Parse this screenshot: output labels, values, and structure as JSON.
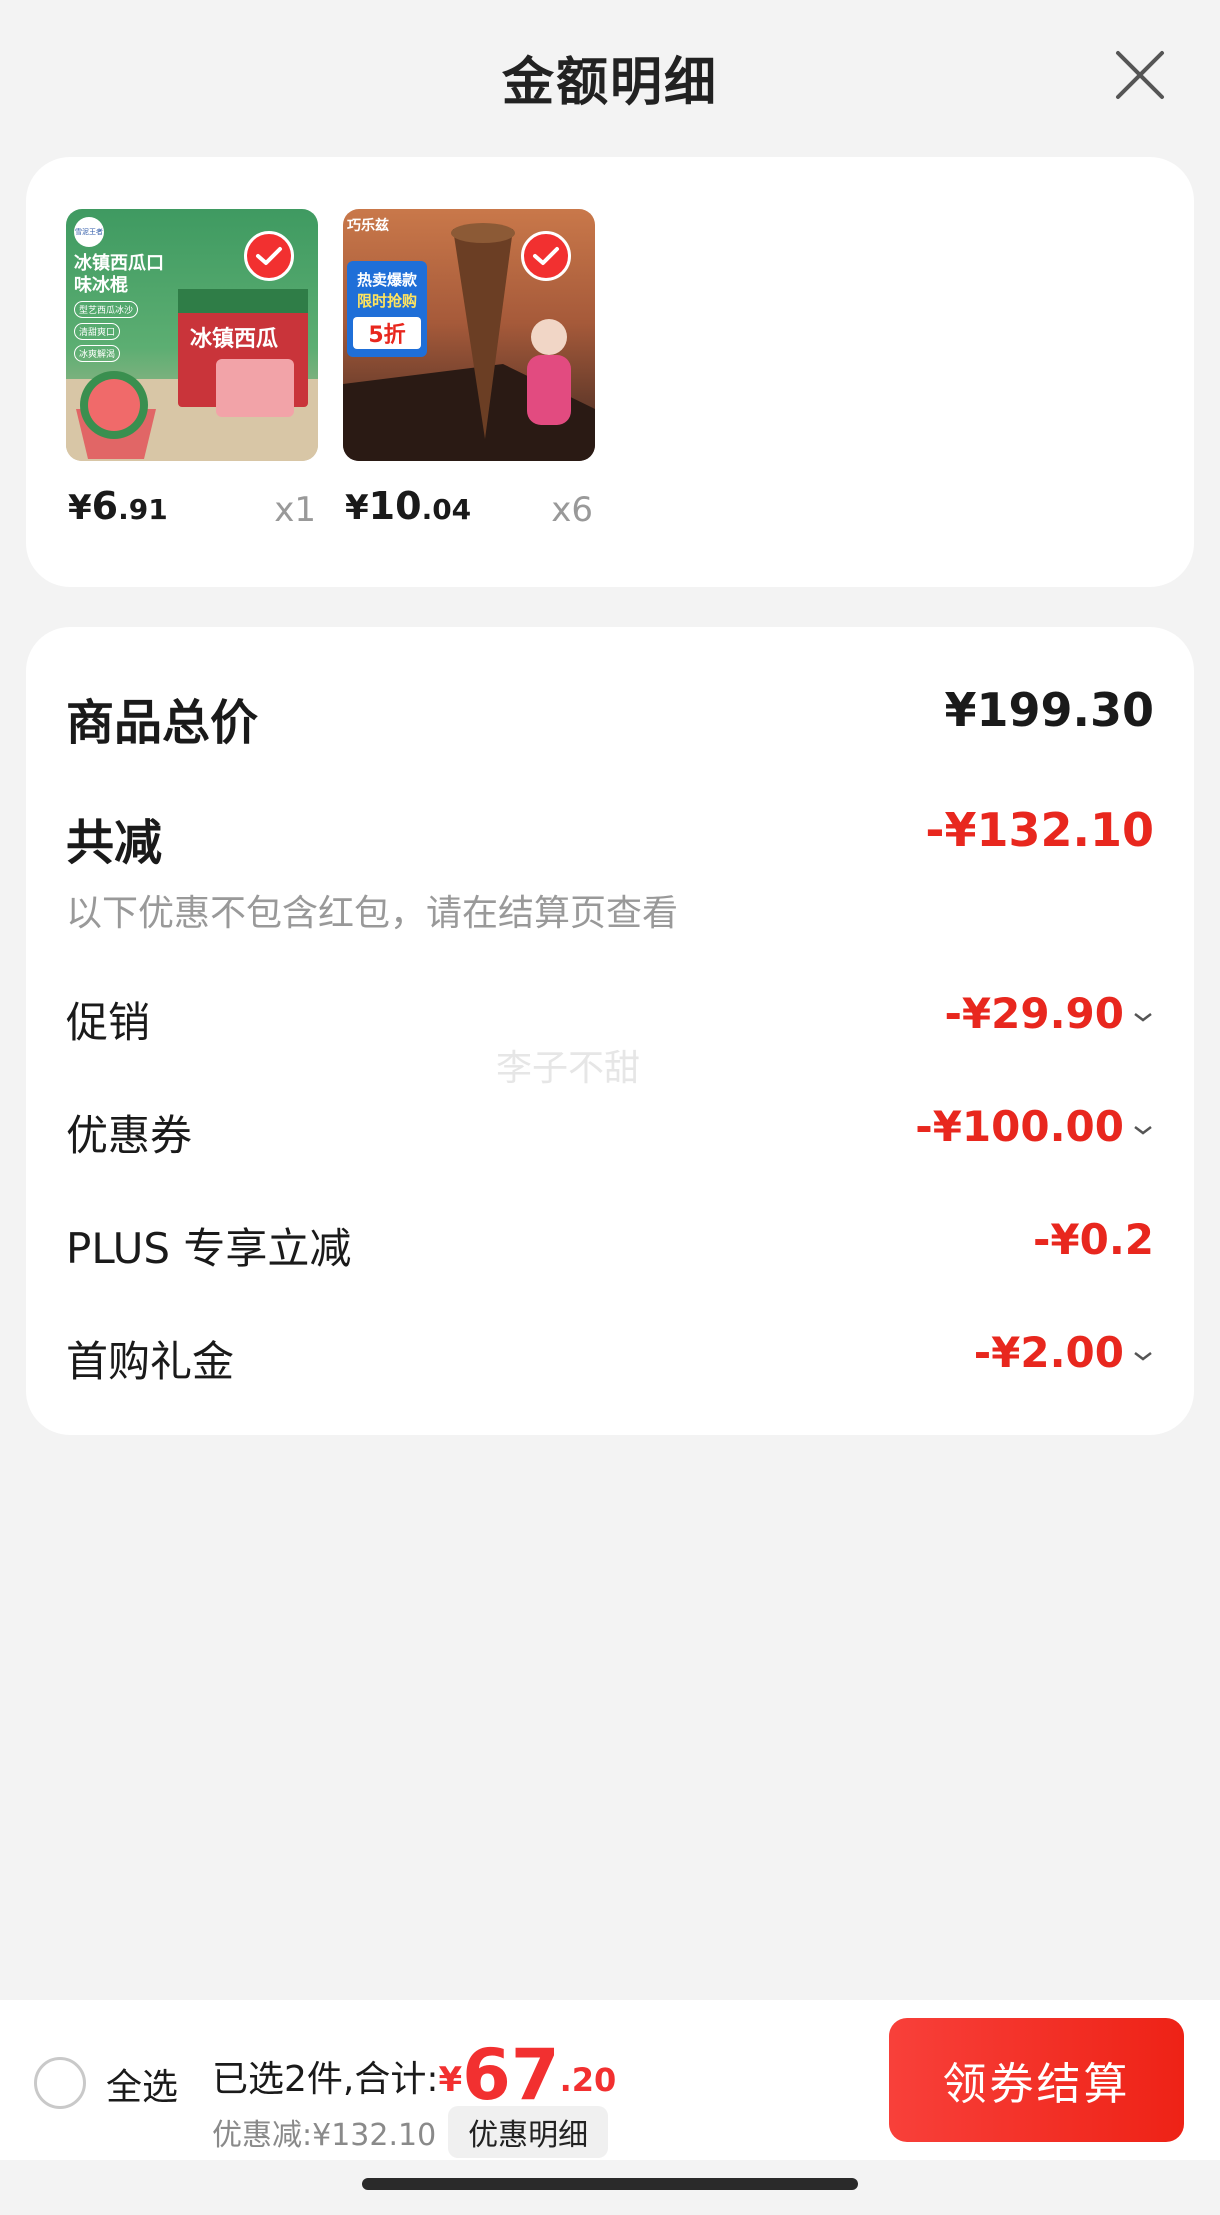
{
  "header": {
    "title": "金额明细"
  },
  "products": [
    {
      "thumb_text": "冰镇西瓜口味冰棍",
      "brand_mark": "雪泥王者",
      "tags": [
        "型艺西瓜冰沙",
        "清甜爽口",
        "冰爽解渴"
      ],
      "box_label": "冰镇西瓜",
      "price_currency": "¥",
      "price_int": "6",
      "price_dec": ".91",
      "qty": "x1",
      "selected": true
    },
    {
      "banner_top": "热卖爆款",
      "banner_mid": "限时抢购",
      "promo": "5折",
      "cone_label": "巧乐兹",
      "price_currency": "¥",
      "price_int": "10",
      "price_dec": ".04",
      "qty": "x6",
      "selected": true
    }
  ],
  "summary": {
    "total_label": "商品总价",
    "total_value": "¥199.30",
    "reduce_label": "共减",
    "reduce_value": "-¥132.10",
    "note": "以下优惠不包含红包，请在结算页查看",
    "watermark": "李子不甜",
    "items": [
      {
        "label": "促销",
        "value": "-¥29.90",
        "expandable": true
      },
      {
        "label": "优惠券",
        "value": "-¥100.00",
        "expandable": true
      },
      {
        "label": "PLUS 专享立减",
        "value": "-¥0.2",
        "expandable": false
      },
      {
        "label": "首购礼金",
        "value": "-¥2.00",
        "expandable": true
      }
    ]
  },
  "bottom_bar": {
    "select_all": "全选",
    "selected_text": "已选2件,合计:",
    "total_currency": "¥",
    "total_int": "67",
    "total_dec": ".20",
    "discount_text": "优惠减:¥132.10",
    "detail_button": "优惠明细",
    "checkout_button": "领券结算"
  },
  "colors": {
    "accent_red": "#e8271e",
    "checkout_red": "#f23030",
    "background": "#f3f3f3"
  }
}
